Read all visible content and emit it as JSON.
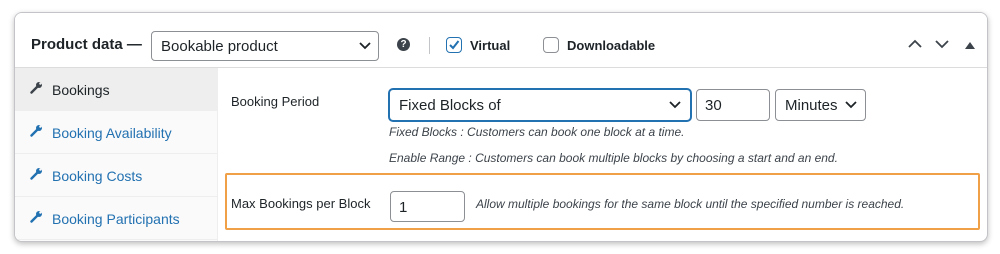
{
  "header": {
    "title": "Product data —",
    "product_type": {
      "selected": "Bookable product"
    },
    "virtual": {
      "label": "Virtual",
      "checked": true
    },
    "downloadable": {
      "label": "Downloadable",
      "checked": false
    }
  },
  "sidebar": {
    "items": [
      {
        "label": "Bookings",
        "active": true
      },
      {
        "label": "Booking Availability",
        "active": false
      },
      {
        "label": "Booking Costs",
        "active": false
      },
      {
        "label": "Booking Participants",
        "active": false
      }
    ]
  },
  "booking_period": {
    "label": "Booking Period",
    "type_selected": "Fixed Blocks of",
    "duration_value": "30",
    "unit_selected": "Minutes",
    "desc_fixed": "Fixed Blocks : Customers can book one block at a time.",
    "desc_range": "Enable Range : Customers can book multiple blocks by choosing a start and an end."
  },
  "max_bookings": {
    "label": "Max Bookings per Block",
    "value": "1",
    "description": "Allow multiple bookings for the same block until the specified number is reached."
  },
  "colors": {
    "accent": "#2271b1",
    "highlight_border": "#f0a047",
    "text": "#1d2327"
  },
  "icons": [
    "chevron-down-icon",
    "help-icon",
    "checkmark-icon",
    "chevron-up-icon",
    "triangle-up-icon",
    "wrench-icon"
  ]
}
